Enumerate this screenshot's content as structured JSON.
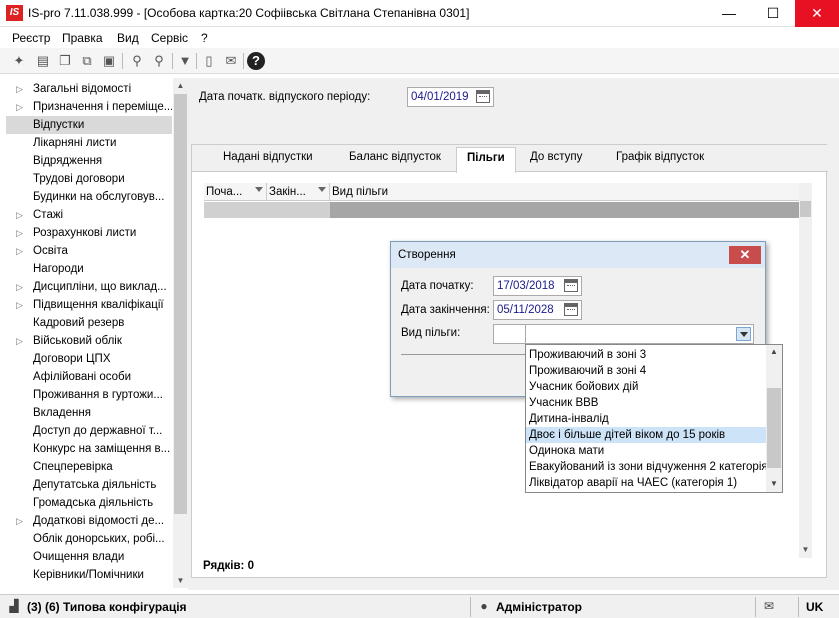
{
  "window": {
    "logo": "IS",
    "title": "IS-pro 7.11.038.999 - [Особова картка:20 Софіівська Світлана Степанівна 0301]",
    "minimize": "—",
    "maximize": "☐",
    "close": "✕"
  },
  "menu": [
    "Реєстр",
    "Правка",
    "Вид",
    "Сервіс",
    "?"
  ],
  "toolbar_icons": [
    "new-doc-icon",
    "copy-icon",
    "duplicate-icon",
    "pages-icon",
    "delete-icon",
    "find-icon",
    "find-next-icon",
    "filter-icon",
    "document-icon",
    "mail-icon",
    "help-icon"
  ],
  "sidebar": {
    "items": [
      {
        "label": "Загальні відомості",
        "arrow": "▷"
      },
      {
        "label": "Призначення і переміще...",
        "arrow": "▷"
      },
      {
        "label": "Відпустки",
        "arrow": "",
        "selected": true
      },
      {
        "label": "Лікарняні листи",
        "arrow": ""
      },
      {
        "label": "Відрядження",
        "arrow": ""
      },
      {
        "label": "Трудові договори",
        "arrow": ""
      },
      {
        "label": "Будинки на обслуговув...",
        "arrow": ""
      },
      {
        "label": "Стажі",
        "arrow": "▷"
      },
      {
        "label": "Розрахункові листи",
        "arrow": "▷"
      },
      {
        "label": "Освіта",
        "arrow": "▷"
      },
      {
        "label": "Нагороди",
        "arrow": ""
      },
      {
        "label": "Дисципліни, що виклад...",
        "arrow": "▷"
      },
      {
        "label": "Підвищення кваліфікації",
        "arrow": "▷"
      },
      {
        "label": "Кадровий резерв",
        "arrow": ""
      },
      {
        "label": "Військовий облік",
        "arrow": "▷"
      },
      {
        "label": "Договори ЦПХ",
        "arrow": ""
      },
      {
        "label": "Афілійовані особи",
        "arrow": ""
      },
      {
        "label": "Проживання в гуртожи...",
        "arrow": ""
      },
      {
        "label": "Вкладення",
        "arrow": ""
      },
      {
        "label": "Доступ до державної т...",
        "arrow": ""
      },
      {
        "label": "Конкурс на заміщення в...",
        "arrow": ""
      },
      {
        "label": "Спецперевірка",
        "arrow": ""
      },
      {
        "label": "Депутатська діяльність",
        "arrow": ""
      },
      {
        "label": "Громадська діяльність",
        "arrow": ""
      },
      {
        "label": "Додаткові відомості де...",
        "arrow": "▷"
      },
      {
        "label": "Облік донорських, робі...",
        "arrow": ""
      },
      {
        "label": "Очищення влади",
        "arrow": ""
      },
      {
        "label": "Керівники/Помічники",
        "arrow": ""
      }
    ]
  },
  "main": {
    "period_label": "Дата початк. відпуского періоду:",
    "period_value": "04/01/2019",
    "tabs": [
      {
        "label": "Надані відпустки"
      },
      {
        "label": "Баланс відпусток"
      },
      {
        "label": "Пільги",
        "active": true
      },
      {
        "label": "До вступу"
      },
      {
        "label": "Графік відпусток"
      }
    ],
    "columns": [
      "Поча...",
      "Закін...",
      "Вид пільги"
    ],
    "rows_label": "Рядків: 0"
  },
  "dialog": {
    "title": "Створення",
    "close": "✕",
    "start_label": "Дата початку:",
    "start_value": "17/03/2018",
    "end_label": "Дата закінчення:",
    "end_value": "05/11/2028",
    "type_label": "Вид пільги:"
  },
  "dropdown": {
    "options": [
      "Проживаючий в зоні 3",
      "Проживаючий в зоні 4",
      "Учасник бойових дій",
      "Учасник ВВВ",
      "Дитина-інвалід",
      "Двоє і більше дітей віком до 15 років",
      "Одинока мати",
      "Евакуйований із зони відчуження 2 категорія",
      "Ліквідатор аварії на ЧАЕС (категорія 1)"
    ],
    "highlighted_index": 5
  },
  "status": {
    "config": "(3) (6) Типова конфігурація",
    "user": "Адміністратор",
    "lang": "UK"
  }
}
